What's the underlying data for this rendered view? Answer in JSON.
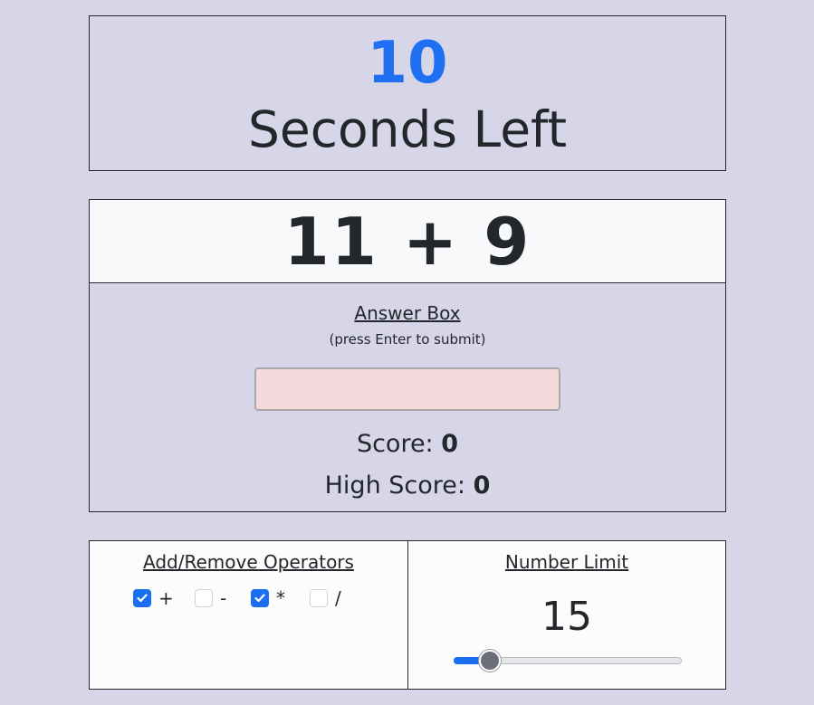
{
  "timer": {
    "seconds": "10",
    "label": "Seconds Left",
    "accent_color": "#1f6ff2"
  },
  "question": {
    "text": "11 + 9"
  },
  "answer": {
    "title": "Answer Box",
    "hint": "(press Enter to submit)",
    "input_value": ""
  },
  "score": {
    "label": "Score: ",
    "value": "0",
    "high_label": "High Score: ",
    "high_value": "0"
  },
  "operators": {
    "title": "Add/Remove Operators",
    "items": [
      {
        "symbol": "+",
        "checked": true
      },
      {
        "symbol": "-",
        "checked": false
      },
      {
        "symbol": "*",
        "checked": true
      },
      {
        "symbol": "/",
        "checked": false
      }
    ]
  },
  "number_limit": {
    "title": "Number Limit",
    "value": "15",
    "slider_fraction": 0.16
  }
}
